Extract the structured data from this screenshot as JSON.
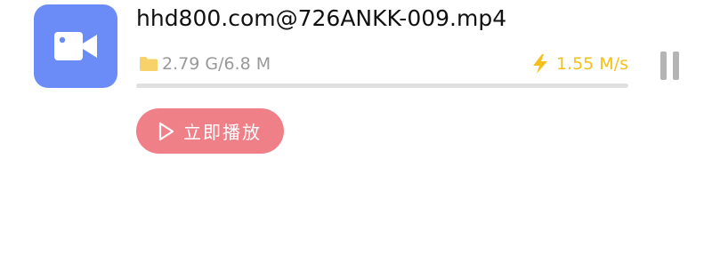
{
  "download": {
    "file_name": "hhd800.com@726ANKK-009.mp4",
    "size_progress": "2.79 G/6.8 M",
    "speed": "1.55 M/s",
    "progress_fraction": 0
  },
  "actions": {
    "play_now_label": "立即播放"
  },
  "icons": {
    "file_type": "video-camera-icon",
    "size": "folder-icon",
    "speed": "lightning-bolt-icon",
    "pause": "pause-icon",
    "play": "play-icon"
  },
  "colors": {
    "file_icon_bg": "#6b8cf7",
    "speed_text": "#f2c11c",
    "play_button_bg": "#f08088",
    "size_text": "#999999",
    "progress_track": "#e0e0e0",
    "pause_icon": "#b4b4b4"
  }
}
